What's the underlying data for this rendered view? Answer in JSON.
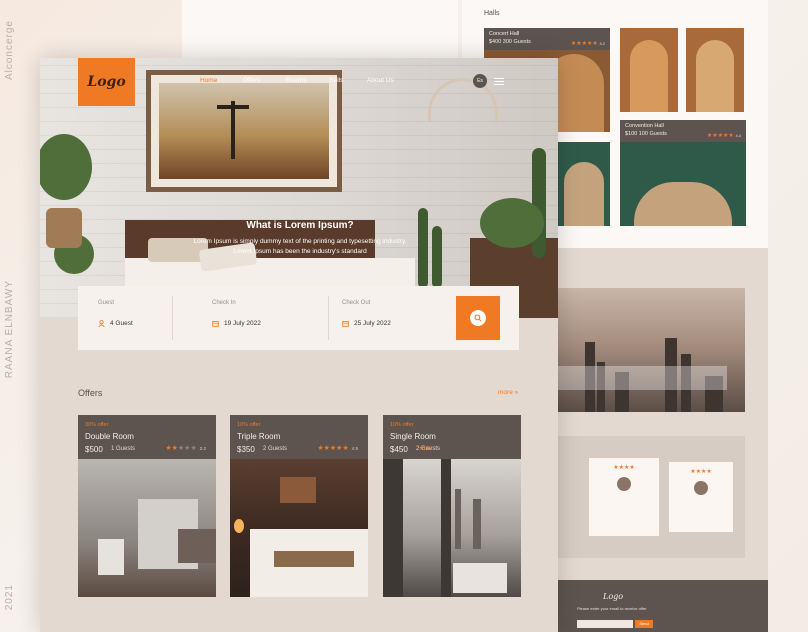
{
  "side": {
    "left_text_top": "Alconcerge",
    "left_text_mid": "RAANA ELNBAWY",
    "left_text_bottom": "2021"
  },
  "brand": {
    "logo": "Logo"
  },
  "nav": {
    "items": [
      "Home",
      "Offers",
      "Rooms",
      "halls",
      "About Us"
    ],
    "lang": "Es"
  },
  "hero": {
    "title": "What is Lorem Ipsum?",
    "text": "Lorem Ipsum is simply dummy text of the printing and typesetting industry. Lorem Ipsum has been the industry's standard"
  },
  "search": {
    "guest_label": "Guest",
    "guest_value": "4 Guest",
    "checkin_label": "Check In",
    "checkin_value": "19 July 2022",
    "checkout_label": "Check Out",
    "checkout_value": "25 July 2022"
  },
  "offers": {
    "title": "Offers",
    "more": "more »",
    "cards": [
      {
        "offer": "30% offer",
        "name": "Double Room",
        "price": "$500",
        "guests": "1 Guests",
        "stars": 2,
        "rating": "2.2"
      },
      {
        "offer": "10% offer",
        "name": "Triple Room",
        "price": "$350",
        "guests": "2 Guests",
        "stars": 5,
        "rating": "4.9"
      },
      {
        "offer": "10% offer",
        "name": "Single Room",
        "price": "$450",
        "guests": "2 Guests",
        "stars": 2,
        "rating": ""
      }
    ]
  },
  "halls": {
    "label": "Halls",
    "cards": [
      {
        "name": "Concert Hall",
        "price": "$400",
        "guests": "300 Guests",
        "rating": "4.2"
      },
      {
        "name": "Convention Hall",
        "price": "$100",
        "guests": "100 Guests",
        "rating": "4.4"
      }
    ]
  },
  "footer": {
    "logo": "Logo",
    "text": "Please enter your email to receive offer",
    "button": "Send"
  },
  "colors": {
    "accent": "#f07a24",
    "dark": "#5d544f",
    "panel": "#e3d9d1"
  }
}
